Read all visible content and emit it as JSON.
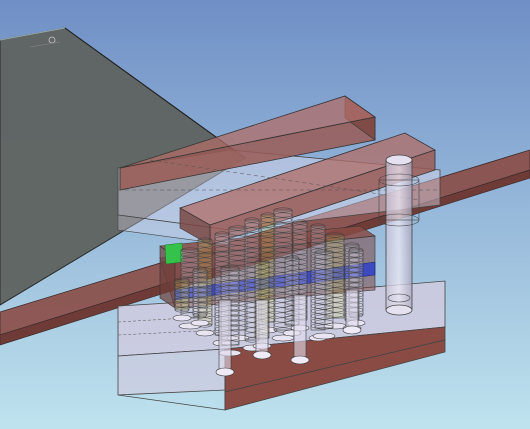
{
  "viewport": {
    "background_top": "#6f8fc6",
    "background_bottom": "#bfe3ee"
  },
  "model": {
    "sheet_fill": "#5f6461",
    "rail_fill": "#8a4b45",
    "upper_bar_fill": "#9a5a55",
    "base_block_fill": "#cfcadf",
    "base_side_fill": "#8a4b45",
    "plate_highlight_blue": "#2f3fc8",
    "plate_highlight_green": "#34c24a",
    "wire_stroke": "#3a3a3a",
    "hidden_line_stroke": "#555555",
    "bushing_tint": "#d8d266"
  }
}
